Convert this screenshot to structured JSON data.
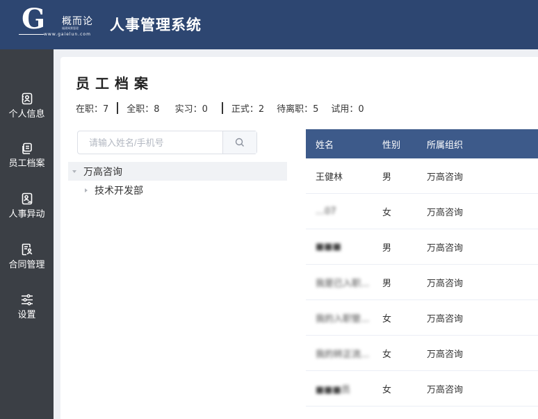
{
  "header": {
    "logo_letter": "G",
    "logo_cn": "概而论",
    "logo_slogan": "福建闽景管理",
    "logo_url": "www.gaielun.com",
    "system_title": "人事管理系统"
  },
  "sidebar": {
    "items": [
      {
        "label": "个人信息",
        "icon": "person-card-icon"
      },
      {
        "label": "员工档案",
        "icon": "file-stack-icon"
      },
      {
        "label": "人事异动",
        "icon": "person-transfer-icon"
      },
      {
        "label": "合同管理",
        "icon": "contract-icon"
      },
      {
        "label": "设置",
        "icon": "sliders-icon"
      }
    ]
  },
  "main": {
    "title": "员工档案",
    "stats": {
      "in_service": "在职：7",
      "full_time": "全职：8",
      "intern": "实习：0",
      "regular": "正式：2",
      "pending_leave": "待离职：5",
      "probation": "试用：0"
    },
    "search": {
      "placeholder": "请输入姓名/手机号",
      "value": ""
    },
    "tree": {
      "root": "万高咨询",
      "child": "技术开发部"
    },
    "table": {
      "headers": [
        "姓名",
        "性别",
        "所属组织"
      ],
      "rows": [
        {
          "name": "王健林",
          "gender": "男",
          "org": "万高咨询"
        },
        {
          "name": "…07",
          "gender": "女",
          "org": "万高咨询"
        },
        {
          "name": "■■■",
          "gender": "男",
          "org": "万高咨询"
        },
        {
          "name": "我是已入职...",
          "gender": "男",
          "org": "万高咨询"
        },
        {
          "name": "我的入职管...",
          "gender": "女",
          "org": "万高咨询"
        },
        {
          "name": "我的转正流...",
          "gender": "女",
          "org": "万高咨询"
        },
        {
          "name": "■■■员",
          "gender": "女",
          "org": "万高咨询"
        }
      ]
    }
  }
}
